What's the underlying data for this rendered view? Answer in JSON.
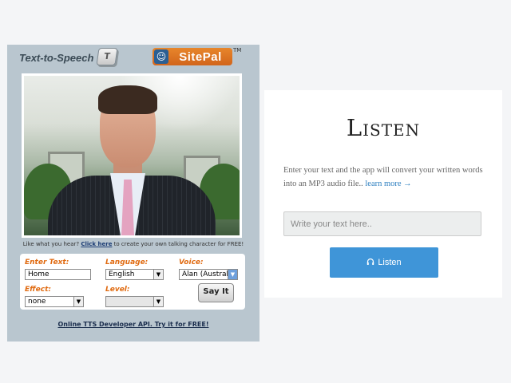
{
  "widget": {
    "title": "Text-to-Speech",
    "key_glyph": "T",
    "logo_text": "SitePal",
    "logo_tm": "TM",
    "promo_prefix": "Like what you hear?",
    "promo_link": "Click here",
    "promo_suffix": "to create your own talking character for FREE!",
    "enter_text_label": "Enter Text:",
    "enter_text_value": "Home",
    "language_label": "Language:",
    "language_value": "English",
    "voice_label": "Voice:",
    "voice_value": "Alan (Australia",
    "effect_label": "Effect:",
    "effect_value": "none",
    "level_label": "Level:",
    "level_value": "",
    "say_it": "Say It",
    "dev_link": "Online TTS Developer API. Try it for FREE!"
  },
  "card": {
    "title": "Listen",
    "description": "Enter your text and the app will convert your written words into an MP3 audio file..",
    "learn_more": "learn more →",
    "input_placeholder": "Write your text here..",
    "button_icon": "headphones-icon",
    "button_label": "Listen"
  },
  "colors": {
    "accent": "#3f95d8",
    "widget_bg": "#b9c6cf",
    "label_orange": "#e06a10"
  }
}
